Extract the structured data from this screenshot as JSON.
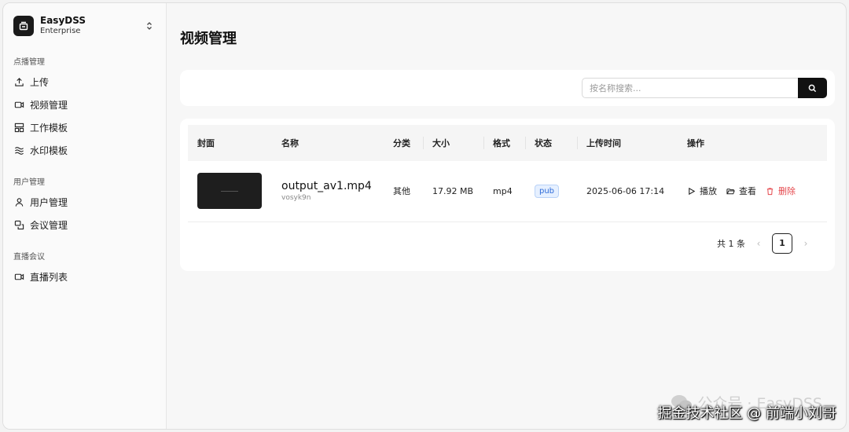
{
  "brand": {
    "name": "EasyDSS",
    "edition": "Enterprise"
  },
  "sidebar": {
    "groups": [
      {
        "label": "点播管理",
        "items": [
          {
            "label": "上传",
            "icon": "upload-icon"
          },
          {
            "label": "视频管理",
            "icon": "video-icon"
          },
          {
            "label": "工作模板",
            "icon": "template-icon"
          },
          {
            "label": "水印模板",
            "icon": "watermark-icon"
          }
        ]
      },
      {
        "label": "用户管理",
        "items": [
          {
            "label": "用户管理",
            "icon": "user-icon"
          },
          {
            "label": "会议管理",
            "icon": "meeting-icon"
          }
        ]
      },
      {
        "label": "直播会议",
        "items": [
          {
            "label": "直播列表",
            "icon": "live-icon"
          }
        ]
      }
    ]
  },
  "main": {
    "title": "视频管理",
    "search": {
      "placeholder": "按名称搜索...",
      "value": ""
    },
    "table": {
      "headers": [
        "封面",
        "名称",
        "分类",
        "大小",
        "格式",
        "状态",
        "上传时间",
        "操作"
      ],
      "rows": [
        {
          "name": "output_av1.mp4",
          "id": "vosyk9n",
          "category": "其他",
          "size": "17.92 MB",
          "format": "mp4",
          "status": "pub",
          "uploaded": "2025-06-06 17:14",
          "actions": {
            "play": "播放",
            "view": "查看",
            "delete": "删除"
          }
        }
      ]
    },
    "pagination": {
      "total_text": "共 1 条",
      "current_page": "1"
    }
  },
  "watermark": {
    "line1": "公众号 · EasyDSS",
    "line2": "掘金技术社区 @ 前端小刘哥"
  },
  "colors": {
    "accent": "#111111",
    "danger": "#e5484d",
    "status_badge": "#2e6bd8"
  }
}
